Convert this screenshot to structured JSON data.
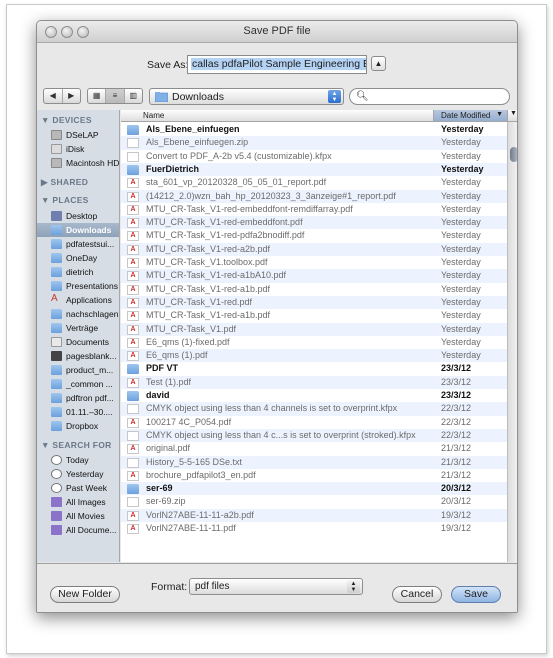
{
  "window": {
    "title": "Save PDF file"
  },
  "save_as": {
    "label": "Save As:",
    "value": "callas pdfaPilot Sample Engineering EN"
  },
  "toolbar": {
    "location": "Downloads",
    "search_placeholder": ""
  },
  "sidebar": {
    "sections": [
      {
        "heading": "DEVICES",
        "items": [
          {
            "label": "DSeLAP",
            "icon": "harddisk-icon"
          },
          {
            "label": "iDisk",
            "icon": "idisk-icon"
          },
          {
            "label": "Macintosh HD",
            "icon": "harddisk-icon"
          }
        ]
      },
      {
        "heading": "SHARED",
        "items": []
      },
      {
        "heading": "PLACES",
        "items": [
          {
            "label": "Desktop",
            "icon": "desktop-icon"
          },
          {
            "label": "Downloads",
            "icon": "folder-icon",
            "selected": true
          },
          {
            "label": "pdfatestsui...",
            "icon": "folder-icon"
          },
          {
            "label": "OneDay",
            "icon": "folder-icon"
          },
          {
            "label": "dietrich",
            "icon": "folder-icon"
          },
          {
            "label": "Presentations",
            "icon": "folder-icon"
          },
          {
            "label": "Applications",
            "icon": "applications-icon"
          },
          {
            "label": "nachschlagen",
            "icon": "folder-icon"
          },
          {
            "label": "Verträge",
            "icon": "folder-icon"
          },
          {
            "label": "Documents",
            "icon": "documents-icon"
          },
          {
            "label": "pagesblank...",
            "icon": "document-icon"
          },
          {
            "label": "product_m...",
            "icon": "folder-icon"
          },
          {
            "label": "_common ...",
            "icon": "folder-icon"
          },
          {
            "label": "pdftron pdf...",
            "icon": "folder-icon"
          },
          {
            "label": "01.11.–30....",
            "icon": "folder-icon"
          },
          {
            "label": "Dropbox",
            "icon": "dropbox-icon"
          }
        ]
      },
      {
        "heading": "SEARCH FOR",
        "items": [
          {
            "label": "Today",
            "icon": "clock-icon"
          },
          {
            "label": "Yesterday",
            "icon": "clock-icon"
          },
          {
            "label": "Past Week",
            "icon": "clock-icon"
          },
          {
            "label": "All Images",
            "icon": "smart-folder-icon"
          },
          {
            "label": "All Movies",
            "icon": "smart-folder-icon"
          },
          {
            "label": "All Docume...",
            "icon": "smart-folder-icon"
          }
        ]
      }
    ]
  },
  "list": {
    "headers": {
      "name": "Name",
      "date": "Date Modified"
    },
    "rows": [
      {
        "name": "Als_Ebene_einfuegen",
        "date": "Yesterday",
        "kind": "folder"
      },
      {
        "name": "Als_Ebene_einfuegen.zip",
        "date": "Yesterday",
        "kind": "file"
      },
      {
        "name": "Convert to PDF_A-2b v5.4 (customizable).kfpx",
        "date": "Yesterday",
        "kind": "file"
      },
      {
        "name": "FuerDietrich",
        "date": "Yesterday",
        "kind": "folder"
      },
      {
        "name": "sta_601_vp_20120328_05_05_01_report.pdf",
        "date": "Yesterday",
        "kind": "pdf"
      },
      {
        "name": "(14212_2.0)wzn_bah_hp_20120323_3_3anzeige#1_report.pdf",
        "date": "Yesterday",
        "kind": "pdf"
      },
      {
        "name": "MTU_CR-Task_V1-red-embeddfont-remdiffarray.pdf",
        "date": "Yesterday",
        "kind": "pdf"
      },
      {
        "name": "MTU_CR-Task_V1-red-embeddfont.pdf",
        "date": "Yesterday",
        "kind": "pdf"
      },
      {
        "name": "MTU_CR-Task_V1-red-pdfa2bnodiff.pdf",
        "date": "Yesterday",
        "kind": "pdf"
      },
      {
        "name": "MTU_CR-Task_V1-red-a2b.pdf",
        "date": "Yesterday",
        "kind": "pdf"
      },
      {
        "name": "MTU_CR-Task_V1.toolbox.pdf",
        "date": "Yesterday",
        "kind": "pdf"
      },
      {
        "name": "MTU_CR-Task_V1-red-a1bA10.pdf",
        "date": "Yesterday",
        "kind": "pdf"
      },
      {
        "name": "MTU_CR-Task_V1-red-a1b.pdf",
        "date": "Yesterday",
        "kind": "pdf"
      },
      {
        "name": "MTU_CR-Task_V1-red.pdf",
        "date": "Yesterday",
        "kind": "pdf"
      },
      {
        "name": "MTU_CR-Task_V1-red-a1b.pdf",
        "date": "Yesterday",
        "kind": "pdf"
      },
      {
        "name": "MTU_CR-Task_V1.pdf",
        "date": "Yesterday",
        "kind": "pdf"
      },
      {
        "name": "E6_qms (1)-fixed.pdf",
        "date": "Yesterday",
        "kind": "pdf"
      },
      {
        "name": "E6_qms (1).pdf",
        "date": "Yesterday",
        "kind": "pdf"
      },
      {
        "name": "PDF VT",
        "date": "23/3/12",
        "kind": "folder"
      },
      {
        "name": "Test (1).pdf",
        "date": "23/3/12",
        "kind": "pdf"
      },
      {
        "name": "david",
        "date": "23/3/12",
        "kind": "folder"
      },
      {
        "name": "CMYK object using less than 4 channels is set to overprint.kfpx",
        "date": "22/3/12",
        "kind": "file"
      },
      {
        "name": "100217 4C_P054.pdf",
        "date": "22/3/12",
        "kind": "pdf"
      },
      {
        "name": "CMYK object using less than 4 c...s is set to overprint (stroked).kfpx",
        "date": "22/3/12",
        "kind": "file"
      },
      {
        "name": "original.pdf",
        "date": "21/3/12",
        "kind": "pdf"
      },
      {
        "name": "History_5-5-165 DSe.txt",
        "date": "21/3/12",
        "kind": "file"
      },
      {
        "name": "brochure_pdfapilot3_en.pdf",
        "date": "21/3/12",
        "kind": "pdf"
      },
      {
        "name": "ser-69",
        "date": "20/3/12",
        "kind": "folder"
      },
      {
        "name": "ser-69.zip",
        "date": "20/3/12",
        "kind": "file"
      },
      {
        "name": "VorlN27ABE-11-11-a2b.pdf",
        "date": "19/3/12",
        "kind": "pdf"
      },
      {
        "name": "VorlN27ABE-11-11.pdf",
        "date": "19/3/12",
        "kind": "pdf"
      }
    ]
  },
  "format": {
    "label": "Format:",
    "value": "pdf files"
  },
  "buttons": {
    "new_folder": "New Folder",
    "cancel": "Cancel",
    "save": "Save"
  }
}
